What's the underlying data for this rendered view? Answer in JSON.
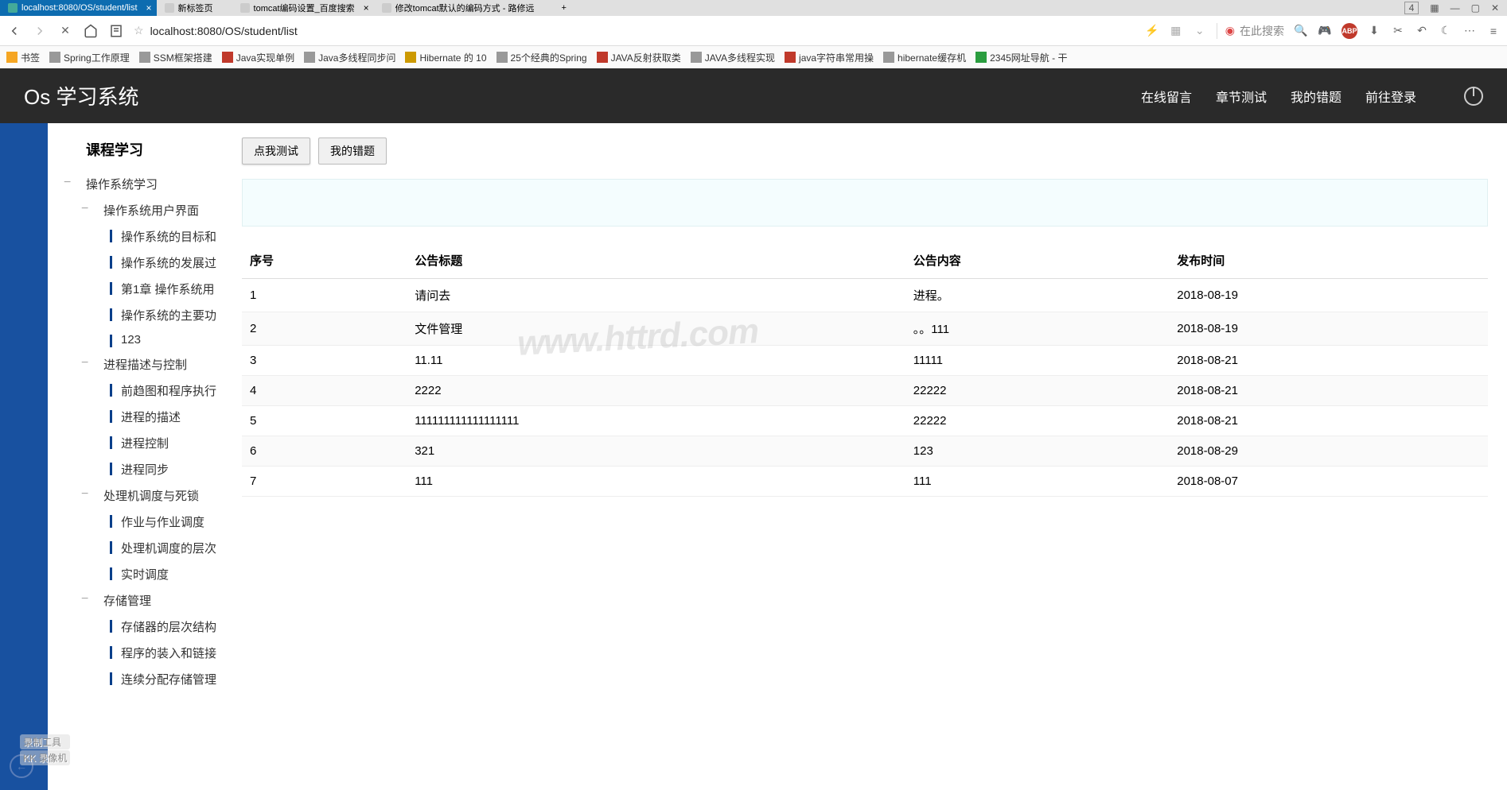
{
  "browser": {
    "tabs": [
      {
        "label": "localhost:8080/OS/student/list",
        "active": true
      },
      {
        "label": "新标签页",
        "active": false
      },
      {
        "label": "tomcat编码设置_百度搜索",
        "active": false,
        "closable": true
      },
      {
        "label": "修改tomcat默认的编码方式 - 路修远",
        "active": false
      }
    ],
    "tab_plus": "+",
    "tab_counter": "4",
    "address": "localhost:8080/OS/student/list",
    "search_placeholder": "在此搜索",
    "bookmarks": [
      "书签",
      "Spring工作原理",
      "SSM框架搭建",
      "Java实现单例",
      "Java多线程同步问",
      "Hibernate 的 10",
      "25个经典的Spring",
      "JAVA反射获取类",
      "JAVA多线程实现",
      "java字符串常用操",
      "hibernate缓存机",
      "2345网址导航 - 干"
    ]
  },
  "app": {
    "title": "Os 学习系统",
    "nav": [
      "在线留言",
      "章节测试",
      "我的错题",
      "前往登录"
    ]
  },
  "sidebar": {
    "title": "课程学习",
    "tree": [
      {
        "label": "操作系统学习",
        "lvl": 1,
        "minus": true
      },
      {
        "label": "操作系统用户界面",
        "lvl": 2,
        "minus": true
      },
      {
        "label": "操作系统的目标和",
        "lvl": 3
      },
      {
        "label": "操作系统的发展过",
        "lvl": 3
      },
      {
        "label": "第1章 操作系统用",
        "lvl": 3
      },
      {
        "label": "操作系统的主要功",
        "lvl": 3
      },
      {
        "label": "123",
        "lvl": 3
      },
      {
        "label": "进程描述与控制",
        "lvl": 2,
        "minus": true
      },
      {
        "label": "前趋图和程序执行",
        "lvl": 3
      },
      {
        "label": "进程的描述",
        "lvl": 3
      },
      {
        "label": "进程控制",
        "lvl": 3
      },
      {
        "label": "进程同步",
        "lvl": 3
      },
      {
        "label": "处理机调度与死锁",
        "lvl": 2,
        "minus": true
      },
      {
        "label": "作业与作业调度",
        "lvl": 3
      },
      {
        "label": "处理机调度的层次",
        "lvl": 3
      },
      {
        "label": "实时调度",
        "lvl": 3
      },
      {
        "label": "存储管理",
        "lvl": 2,
        "minus": true
      },
      {
        "label": "存储器的层次结构",
        "lvl": 3
      },
      {
        "label": "程序的装入和链接",
        "lvl": 3
      },
      {
        "label": "连续分配存储管理",
        "lvl": 3
      }
    ]
  },
  "buttons": {
    "test_me": "点我测试",
    "my_wrongs": "我的错题"
  },
  "table": {
    "headers": [
      "序号",
      "公告标题",
      "公告内容",
      "发布时间"
    ],
    "rows": [
      [
        "1",
        "请问去",
        "进程。",
        "2018-08-19"
      ],
      [
        "2",
        "文件管理",
        "     。。111",
        "2018-08-19"
      ],
      [
        "3",
        "11.11",
        "11111",
        "2018-08-21"
      ],
      [
        "4",
        "2222",
        "22222",
        "2018-08-21"
      ],
      [
        "5",
        "111111111111111111",
        "22222",
        "2018-08-21"
      ],
      [
        "6",
        "321",
        "123",
        "2018-08-29"
      ],
      [
        "7",
        "111",
        "111",
        "2018-08-07"
      ]
    ]
  },
  "watermark": "www.httrd.com",
  "recorder": {
    "l1": "录制工具",
    "l2": "KK 录像机"
  }
}
